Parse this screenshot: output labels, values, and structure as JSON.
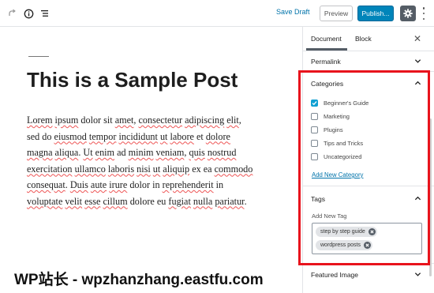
{
  "toolbar": {
    "save_draft": "Save Draft",
    "preview": "Preview",
    "publish": "Publish..."
  },
  "post": {
    "title": "This is a Sample Post",
    "body": [
      {
        "t": "Lorem",
        "u": true
      },
      {
        "t": " "
      },
      {
        "t": "ipsum",
        "u": true
      },
      {
        "t": " dolor sit "
      },
      {
        "t": "amet",
        "u": true
      },
      {
        "t": ", "
      },
      {
        "t": "consectetur",
        "u": true
      },
      {
        "t": " "
      },
      {
        "t": "adipiscing",
        "u": true
      },
      {
        "t": " "
      },
      {
        "t": "elit",
        "u": true
      },
      {
        "t": ", sed do "
      },
      {
        "t": "eiusmod",
        "u": true
      },
      {
        "t": " "
      },
      {
        "t": "tempor",
        "u": true
      },
      {
        "t": " "
      },
      {
        "t": "incididunt",
        "u": true
      },
      {
        "t": " "
      },
      {
        "t": "ut",
        "u": true
      },
      {
        "t": " "
      },
      {
        "t": "labore",
        "u": true
      },
      {
        "t": " et "
      },
      {
        "t": "dolore",
        "u": true
      },
      {
        "t": " "
      },
      {
        "t": "magna",
        "u": true
      },
      {
        "t": " "
      },
      {
        "t": "aliqua",
        "u": true
      },
      {
        "t": ". "
      },
      {
        "t": "Ut",
        "u": true
      },
      {
        "t": " "
      },
      {
        "t": "enim",
        "u": true
      },
      {
        "t": " ad "
      },
      {
        "t": "minim",
        "u": true
      },
      {
        "t": " "
      },
      {
        "t": "veniam",
        "u": true
      },
      {
        "t": ", "
      },
      {
        "t": "quis",
        "u": true
      },
      {
        "t": " "
      },
      {
        "t": "nostrud",
        "u": true
      },
      {
        "t": " "
      },
      {
        "t": "exercitation",
        "u": true
      },
      {
        "t": " "
      },
      {
        "t": "ullamco",
        "u": true
      },
      {
        "t": " "
      },
      {
        "t": "laboris",
        "u": true
      },
      {
        "t": " "
      },
      {
        "t": "nisi",
        "u": true
      },
      {
        "t": " "
      },
      {
        "t": "ut",
        "u": true
      },
      {
        "t": " "
      },
      {
        "t": "aliquip",
        "u": true
      },
      {
        "t": " ex ea "
      },
      {
        "t": "commodo",
        "u": true
      },
      {
        "t": " "
      },
      {
        "t": "consequat",
        "u": true
      },
      {
        "t": ". "
      },
      {
        "t": "Duis",
        "u": true
      },
      {
        "t": " "
      },
      {
        "t": "aute",
        "u": true
      },
      {
        "t": " "
      },
      {
        "t": "irure",
        "u": true
      },
      {
        "t": " dolor in "
      },
      {
        "t": "reprehenderit",
        "u": true
      },
      {
        "t": " in "
      },
      {
        "t": "voluptate",
        "u": true
      },
      {
        "t": " "
      },
      {
        "t": "velit",
        "u": true
      },
      {
        "t": " "
      },
      {
        "t": "esse",
        "u": true
      },
      {
        "t": " "
      },
      {
        "t": "cillum",
        "u": true
      },
      {
        "t": " dolore eu "
      },
      {
        "t": "fugiat",
        "u": true
      },
      {
        "t": " "
      },
      {
        "t": "nulla",
        "u": true
      },
      {
        "t": " "
      },
      {
        "t": "pariatur",
        "u": true
      },
      {
        "t": "."
      }
    ]
  },
  "sidebar": {
    "tabs": {
      "document": "Document",
      "block": "Block"
    },
    "permalink": "Permalink",
    "categories": {
      "heading": "Categories",
      "items": [
        {
          "label": "Beginner's Guide",
          "checked": true
        },
        {
          "label": "Marketing",
          "checked": false
        },
        {
          "label": "Plugins",
          "checked": false
        },
        {
          "label": "Tips and Tricks",
          "checked": false
        },
        {
          "label": "Uncategorized",
          "checked": false
        }
      ],
      "add_new": "Add New Category"
    },
    "tags": {
      "heading": "Tags",
      "add_new_label": "Add New Tag",
      "tokens": [
        "step by step guide",
        "wordpress posts"
      ]
    },
    "featured_image": "Featured Image"
  },
  "watermark": "WP站长 - wpzhanzhang.eastfu.com",
  "colors": {
    "accent": "#0085ba",
    "link": "#0073aa",
    "checkbox": "#11a0d2",
    "highlight": "#e8131c"
  }
}
